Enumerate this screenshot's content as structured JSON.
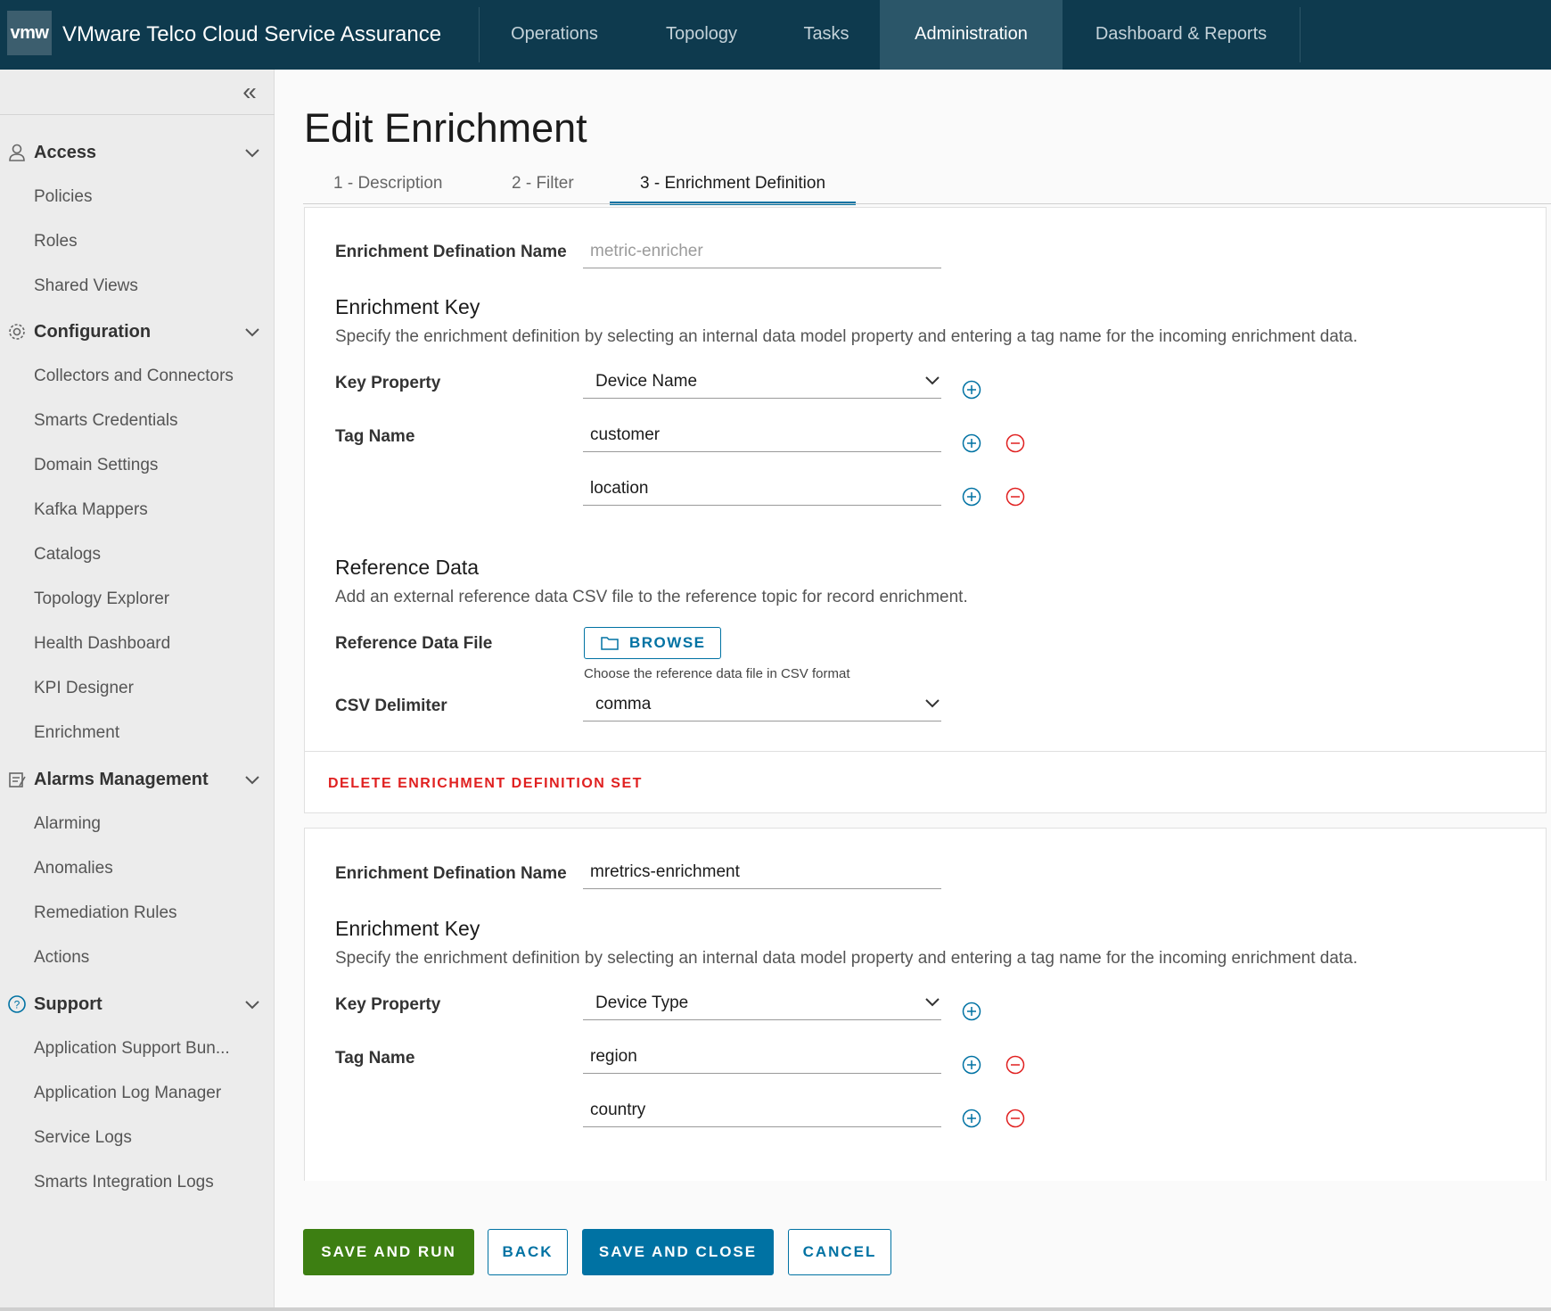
{
  "app": {
    "logo": "vmw",
    "title": "VMware Telco Cloud Service Assurance"
  },
  "nav": {
    "items": [
      "Operations",
      "Topology",
      "Tasks",
      "Administration",
      "Dashboard & Reports"
    ],
    "active": "Administration"
  },
  "sidebar": {
    "collapse_glyph": "«",
    "groups": [
      {
        "label": "Access",
        "icon": "user-icon",
        "items": [
          "Policies",
          "Roles",
          "Shared Views"
        ]
      },
      {
        "label": "Configuration",
        "icon": "gear-icon",
        "items": [
          "Collectors and Connectors",
          "Smarts Credentials",
          "Domain Settings",
          "Kafka Mappers",
          "Catalogs",
          "Topology Explorer",
          "Health Dashboard",
          "KPI Designer",
          "Enrichment"
        ]
      },
      {
        "label": "Alarms Management",
        "icon": "alarms-icon",
        "items": [
          "Alarming",
          "Anomalies",
          "Remediation Rules",
          "Actions"
        ]
      },
      {
        "label": "Support",
        "icon": "help-icon",
        "items": [
          "Application Support Bun...",
          "Application Log Manager",
          "Service Logs",
          "Smarts Integration Logs"
        ]
      }
    ]
  },
  "page": {
    "title": "Edit Enrichment",
    "tabs": [
      "1 - Description",
      "2 - Filter",
      "3 - Enrichment Definition"
    ],
    "active_tab": "3 - Enrichment Definition"
  },
  "definitions": [
    {
      "name_label": "Enrichment Defination Name",
      "name_value": "",
      "name_placeholder": "metric-enricher",
      "key_title": "Enrichment Key",
      "key_desc": "Specify the enrichment definition by selecting an internal data model property and entering a tag name for the incoming enrichment data.",
      "key_property_label": "Key Property",
      "key_property_value": "Device Name",
      "tag_name_label": "Tag Name",
      "tags": [
        "customer",
        "location"
      ],
      "ref_title": "Reference Data",
      "ref_desc": "Add an external reference data CSV file to the reference topic for record enrichment.",
      "ref_file_label": "Reference Data File",
      "browse_label": "BROWSE",
      "browse_hint": "Choose the reference data file in CSV format",
      "csv_label": "CSV Delimiter",
      "csv_value": "comma",
      "delete_label": "DELETE ENRICHMENT DEFINITION SET"
    },
    {
      "name_label": "Enrichment Defination Name",
      "name_value": "mretrics-enrichment",
      "key_title": "Enrichment Key",
      "key_desc": "Specify the enrichment definition by selecting an internal data model property and entering a tag name for the incoming enrichment data.",
      "key_property_label": "Key Property",
      "key_property_value": "Device Type",
      "tag_name_label": "Tag Name",
      "tags": [
        "region",
        "country"
      ]
    }
  ],
  "actions": {
    "save_run": "SAVE AND RUN",
    "back": "BACK",
    "save_close": "SAVE AND CLOSE",
    "cancel": "CANCEL"
  },
  "colors": {
    "header_bg": "#0e3a4e",
    "accent": "#0072a3",
    "success": "#3d7f12",
    "danger": "#e02020"
  }
}
